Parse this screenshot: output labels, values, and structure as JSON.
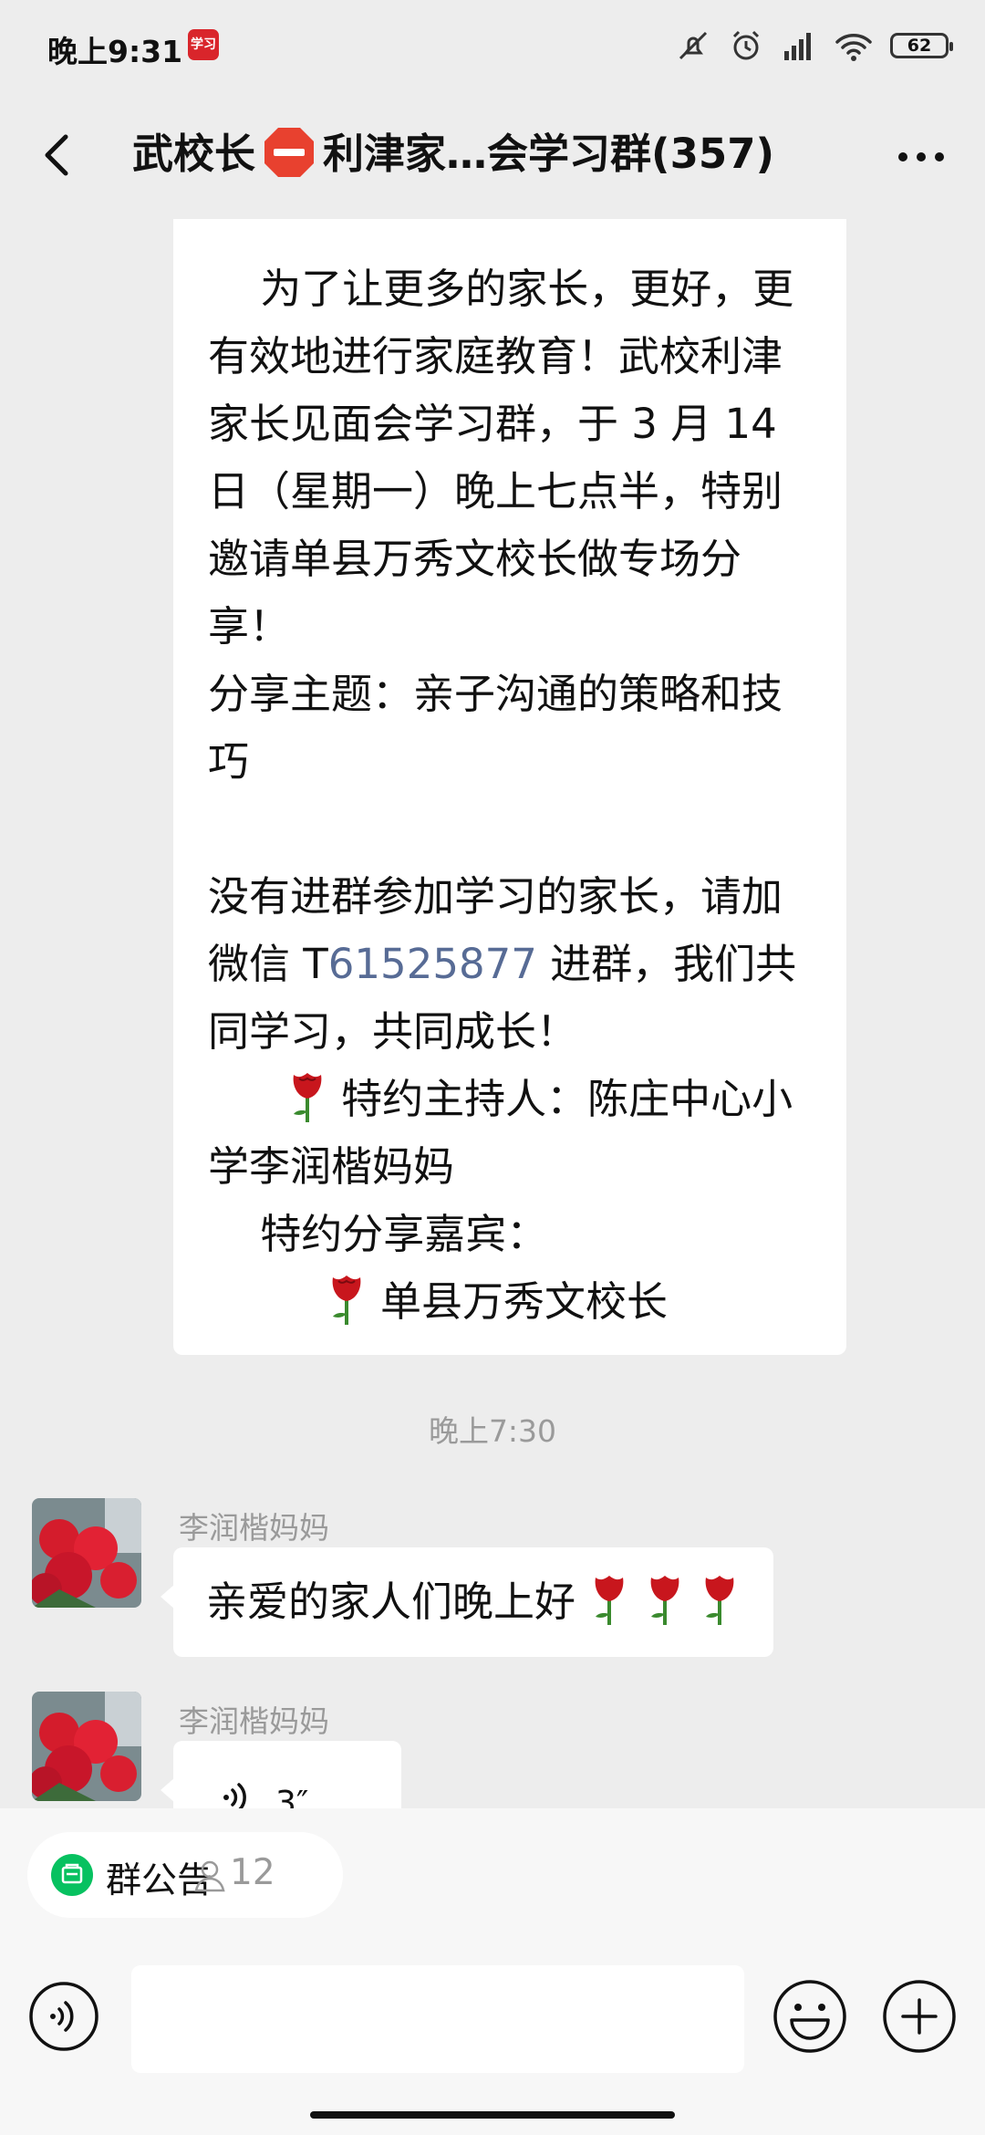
{
  "status_bar": {
    "time": "晚上9:31",
    "app_icon_text": "学习",
    "battery": "62"
  },
  "header": {
    "title_prefix": "武校长",
    "title_suffix": "利津家…会学习群(357)"
  },
  "chat": {
    "announcement": {
      "line1": "    为了让更多的家长，更好，更有效地进行家庭教育！武校利津家长见面会学习群，于 3 月 14 日（星期一）晚上七点半，特别邀请单县万秀文校长做专场分享！",
      "line2": "分享主题：亲子沟通的策略和技巧",
      "line3_pre": "没有进群参加学习的家长，请加微信 T",
      "line3_link": "61525877",
      "line3_post": " 进群，我们共同学习，共同成长！",
      "host": " 特约主持人：陈庄中心小学李润楷妈妈",
      "guest_label": "    特约分享嘉宾：",
      "guest": " 单县万秀文校长"
    },
    "timestamp": "晚上7:30",
    "messages": [
      {
        "sender": "李润楷妈妈",
        "text": "亲爱的家人们晚上好"
      },
      {
        "sender": "李润楷妈妈",
        "voice_duration": "3″"
      }
    ]
  },
  "bottom_bar": {
    "notice_label": "群公告",
    "notice_count": "12",
    "input_placeholder": ""
  },
  "colors": {
    "link": "#576b95",
    "green": "#07c160",
    "background": "#ededed"
  }
}
